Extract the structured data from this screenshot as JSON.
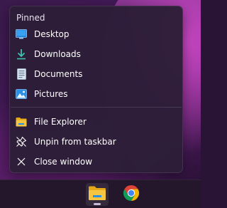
{
  "jumplist": {
    "section_title": "Pinned",
    "pinned": [
      {
        "label": "Desktop",
        "icon": "desktop-icon"
      },
      {
        "label": "Downloads",
        "icon": "download-icon"
      },
      {
        "label": "Documents",
        "icon": "documents-icon"
      },
      {
        "label": "Pictures",
        "icon": "pictures-icon"
      }
    ],
    "tasks": [
      {
        "label": "File Explorer",
        "icon": "file-explorer-icon"
      },
      {
        "label": "Unpin from taskbar",
        "icon": "unpin-icon"
      },
      {
        "label": "Close window",
        "icon": "close-icon"
      }
    ]
  },
  "taskbar": {
    "apps": [
      {
        "icon": "file-explorer-icon",
        "active": true
      },
      {
        "icon": "chrome-icon",
        "active": false
      }
    ]
  },
  "colors": {
    "menu_background": "#2c1e38",
    "taskbar_background": "#24172c",
    "text": "#ffffff",
    "folder_yellow": "#f5c542",
    "downloads_teal": "#3fc1b0",
    "pictures_blue": "#2b8fe6"
  }
}
